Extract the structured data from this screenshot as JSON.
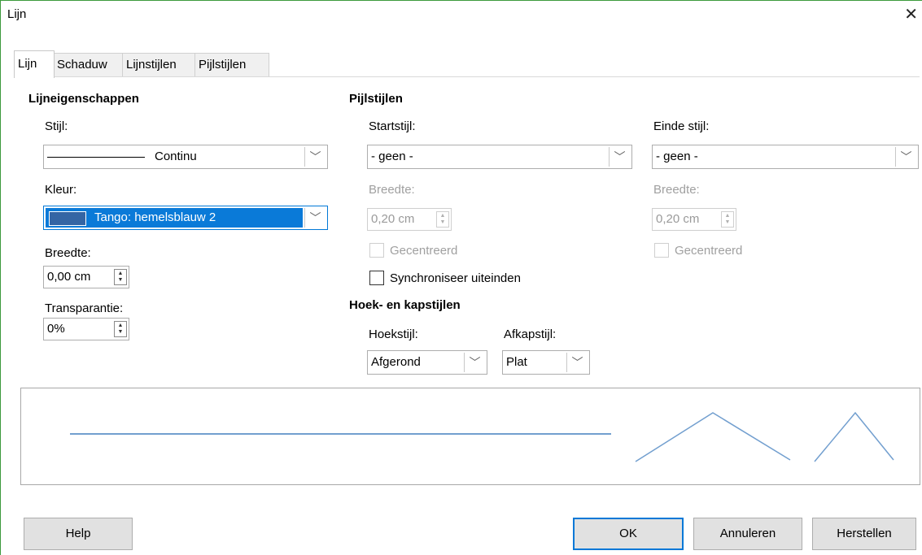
{
  "window": {
    "title": "Lijn",
    "close_glyph": "✕"
  },
  "tabs": [
    {
      "label": "Lijn"
    },
    {
      "label": "Schaduw"
    },
    {
      "label": "Lijnstijlen"
    },
    {
      "label": "Pijlstijlen"
    }
  ],
  "line_props": {
    "heading": "Lijneigenschappen",
    "style_label": "Stijl:",
    "style_value": "Continu",
    "color_label": "Kleur:",
    "color_value": "Tango: hemelsblauw 2",
    "color_swatch": "#3465a4",
    "width_label": "Breedte:",
    "width_value": "0,00 cm",
    "transparency_label": "Transparantie:",
    "transparency_value": "0%"
  },
  "arrow_styles": {
    "heading": "Pijlstijlen",
    "start_label": "Startstijl:",
    "start_value": "- geen -",
    "start_width_label": "Breedte:",
    "start_width_value": "0,20 cm",
    "start_centered_label": "Gecentreerd",
    "end_label": "Einde stijl:",
    "end_value": "- geen -",
    "end_width_label": "Breedte:",
    "end_width_value": "0,20 cm",
    "end_centered_label": "Gecentreerd",
    "sync_label": "Synchroniseer uiteinden"
  },
  "corner_cap": {
    "heading": "Hoek- en kapstijlen",
    "corner_label": "Hoekstijl:",
    "corner_value": "Afgerond",
    "cap_label": "Afkapstijl:",
    "cap_value": "Plat"
  },
  "preview": {
    "line_color": "#729fcf"
  },
  "buttons": {
    "help": "Help",
    "ok": "OK",
    "cancel": "Annuleren",
    "reset": "Herstellen"
  },
  "colors": {
    "accent": "#0078d7",
    "selection": "#0a7ad8"
  }
}
